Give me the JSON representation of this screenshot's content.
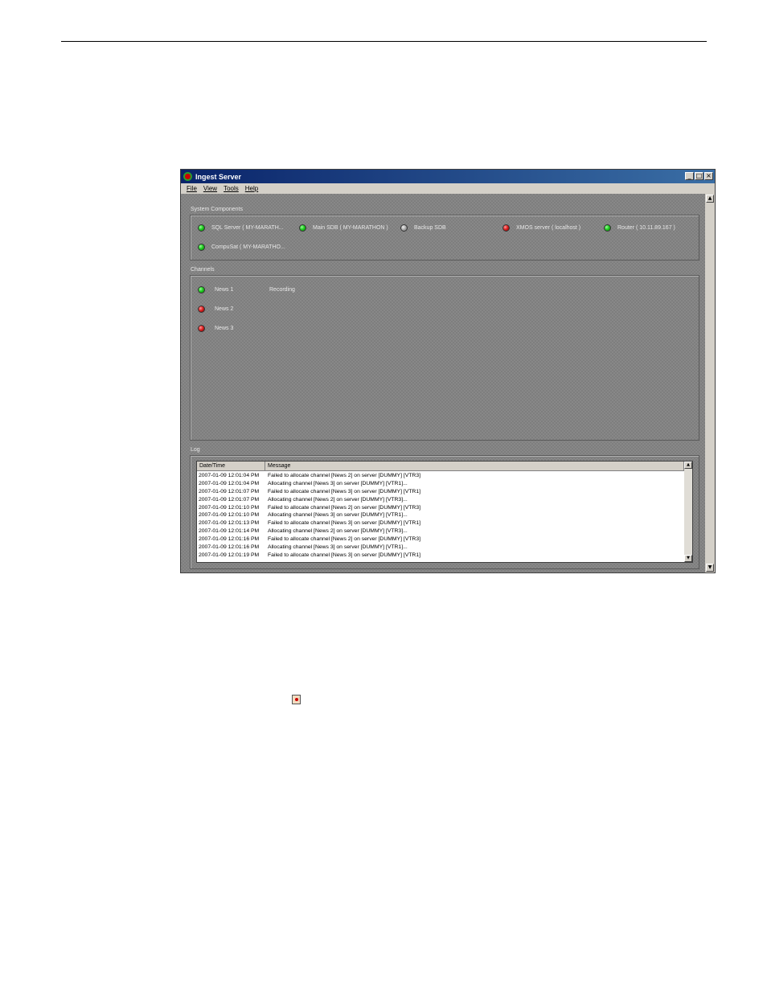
{
  "window": {
    "title": "Ingest Server",
    "buttons": {
      "minimize": "_",
      "maximize": "□",
      "close": "×"
    }
  },
  "menu": [
    "File",
    "View",
    "Tools",
    "Help"
  ],
  "system_components": {
    "label": "System Components",
    "items": [
      {
        "name": "SQL Server ( MY-MARATH...",
        "status": "green"
      },
      {
        "name": "Main SDB ( MY-MARATHON )",
        "status": "green"
      },
      {
        "name": "Backup SDB",
        "status": "gray"
      },
      {
        "name": "XMOS server ( localhost )",
        "status": "red"
      },
      {
        "name": "Router ( 10.11.89.167 )",
        "status": "green"
      },
      {
        "name": "CompuSat ( MY-MARATHO...",
        "status": "green"
      }
    ]
  },
  "channels": {
    "label": "Channels",
    "items": [
      {
        "name": "News 1",
        "status": "green",
        "state": "Recording"
      },
      {
        "name": "News 2",
        "status": "red",
        "state": ""
      },
      {
        "name": "News 3",
        "status": "red",
        "state": ""
      }
    ]
  },
  "log": {
    "label": "Log",
    "columns": [
      "Date/Time",
      "Message"
    ],
    "rows": [
      [
        "2007-01-09 12:01:04 PM",
        "Failed to allocate channel [News 2] on server [DUMMY] [VTR3]"
      ],
      [
        "2007-01-09 12:01:04 PM",
        "Allocating channel [News 3] on server [DUMMY] [VTR1]..."
      ],
      [
        "2007-01-09 12:01:07 PM",
        "Failed to allocate channel [News 3] on server [DUMMY] [VTR1]"
      ],
      [
        "2007-01-09 12:01:07 PM",
        "Allocating channel [News 2] on server [DUMMY] [VTR3]..."
      ],
      [
        "2007-01-09 12:01:10 PM",
        "Failed to allocate channel [News 2] on server [DUMMY] [VTR3]"
      ],
      [
        "2007-01-09 12:01:10 PM",
        "Allocating channel [News 3] on server [DUMMY] [VTR1]..."
      ],
      [
        "2007-01-09 12:01:13 PM",
        "Failed to allocate channel [News 3] on server [DUMMY] [VTR1]"
      ],
      [
        "2007-01-09 12:01:14 PM",
        "Allocating channel [News 2] on server [DUMMY] [VTR3]..."
      ],
      [
        "2007-01-09 12:01:16 PM",
        "Failed to allocate channel [News 2] on server [DUMMY] [VTR3]"
      ],
      [
        "2007-01-09 12:01:16 PM",
        "Allocating channel [News 3] on server [DUMMY] [VTR1]..."
      ],
      [
        "2007-01-09 12:01:19 PM",
        "Failed to allocate channel [News 3] on server [DUMMY] [VTR1]"
      ]
    ]
  },
  "icons": {
    "app": "ingest-server-app-icon",
    "inline": "ingest-server-tray-icon"
  },
  "colors": {
    "titlebar": "#0a246a",
    "status_green": "#22cc22",
    "status_red": "#dd2222",
    "status_gray": "#aaaaaa"
  }
}
